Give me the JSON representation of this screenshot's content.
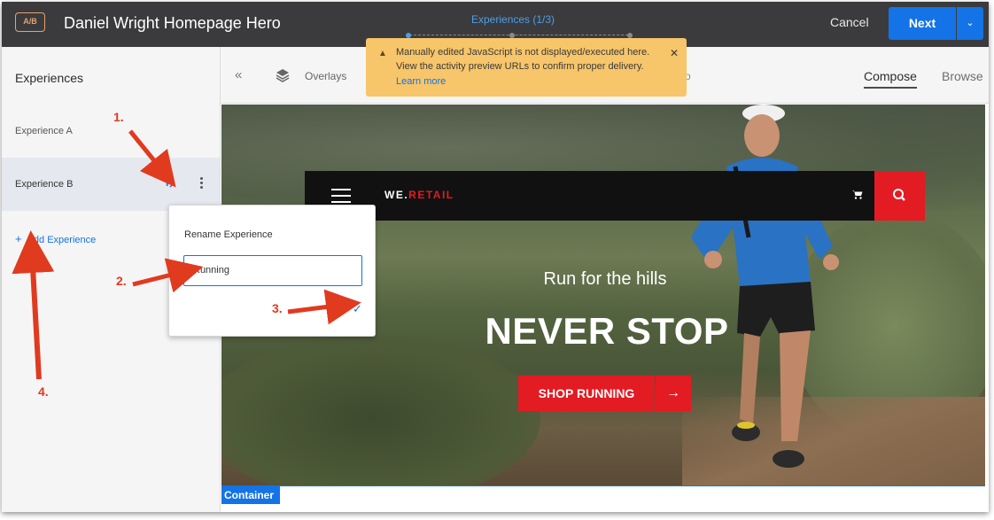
{
  "header": {
    "badge": "A/B",
    "title": "Daniel Wright Homepage Hero",
    "wizard_label": "Experiences (1/3)",
    "cancel": "Cancel",
    "next": "Next"
  },
  "sidebar": {
    "title": "Experiences",
    "items": [
      {
        "label": "Experience A"
      },
      {
        "label": "Experience B"
      }
    ],
    "add_label": "Add Experience"
  },
  "toolbar": {
    "overlays": "Overlays",
    "compose": "Compose",
    "browse": "Browse"
  },
  "alert": {
    "line1": "Manually edited JavaScript is not displayed/executed here.",
    "line2": "View the activity preview URLs to confirm proper delivery.",
    "learn_more": "Learn more"
  },
  "rename": {
    "title": "Rename Experience",
    "value": "Running"
  },
  "hero": {
    "brand_prefix": "WE.",
    "brand_accent": "RETAIL",
    "subtitle": "Run for the hills",
    "title": "NEVER STOP",
    "cta": "SHOP RUNNING"
  },
  "canvas": {
    "container_tag": "Container"
  },
  "annotations": {
    "a1": "1.",
    "a2": "2.",
    "a3": "3.",
    "a4": "4."
  },
  "colors": {
    "header_bg": "#3b3b3d",
    "accent_blue": "#1473e6",
    "brand_red": "#e31b23",
    "alert_bg": "#f7c56a",
    "annotation": "#e03a1f"
  }
}
